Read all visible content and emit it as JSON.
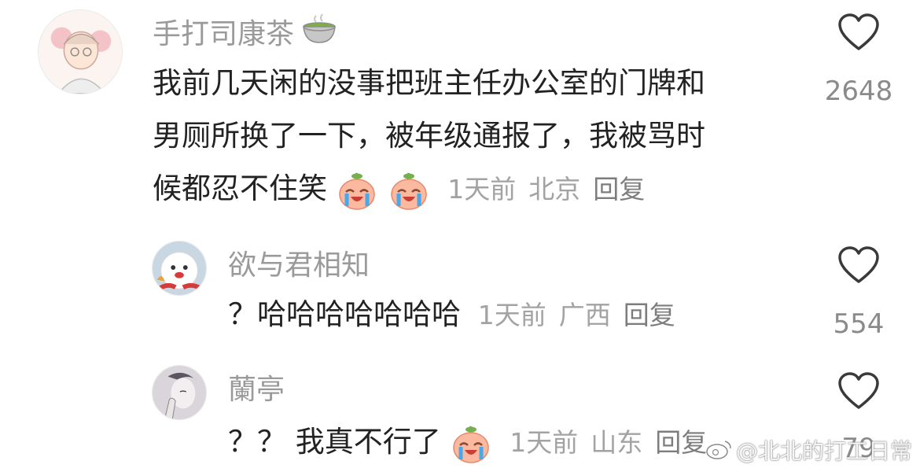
{
  "comments": [
    {
      "username": "手打司康茶",
      "username_emoji": "tea-cup-icon",
      "text_lines": [
        "我前几天闲的没事把班主任办公室的门牌和",
        "男厕所换了一下，被年级通报了，我被骂时",
        "候都忍不住笑"
      ],
      "emojis": [
        "crying-laughing-peach-emoji",
        "crying-laughing-peach-emoji"
      ],
      "time": "1天前",
      "location": "北京",
      "reply_label": "回复",
      "likes": "2648"
    },
    {
      "username": "欲与君相知",
      "text_lines": [
        "？哈哈哈哈哈哈哈"
      ],
      "emojis": [],
      "time": "1天前",
      "location": "广西",
      "reply_label": "回复",
      "likes": "554"
    },
    {
      "username": "蘭亭",
      "text_lines": [
        "？？ 我真不行了"
      ],
      "emojis": [
        "crying-laughing-peach-emoji"
      ],
      "time": "1天前",
      "location": "山东",
      "reply_label": "回复",
      "likes": "79"
    }
  ],
  "watermark": "@北北的打工日常",
  "colors": {
    "username": "#9a9a9a",
    "text": "#222222",
    "meta": "#a3a3a3",
    "like_count": "#8a8a8a"
  }
}
